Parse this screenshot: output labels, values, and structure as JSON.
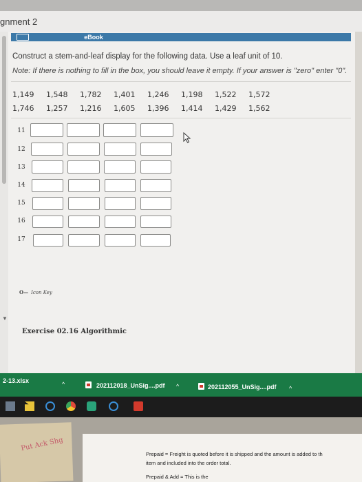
{
  "header": {
    "assignment_title": "gnment 2"
  },
  "ebook": {
    "label": "eBook"
  },
  "question": {
    "text": "Construct a stem-and-leaf display for the following data. Use a leaf unit of 10.",
    "note": "Note: If there is nothing to fill in the box, you should leave it empty. If your answer is \"zero\" enter \"0\"."
  },
  "data": {
    "row1": [
      "1,149",
      "1,548",
      "1,782",
      "1,401",
      "1,246",
      "1,198",
      "1,522",
      "1,572"
    ],
    "row2": [
      "1,746",
      "1,257",
      "1,216",
      "1,605",
      "1,396",
      "1,414",
      "1,429",
      "1,562"
    ]
  },
  "stems": [
    "11",
    "12",
    "13",
    "14",
    "15",
    "16",
    "17"
  ],
  "key": {
    "label": "Icon Key"
  },
  "exercise": {
    "label": "Exercise 02.16 Algorithmic"
  },
  "downloads": {
    "file1": "2-13.xlsx",
    "file2": "202112018_UnSig....pdf",
    "file3": "202112055_UnSig....pdf"
  },
  "paper": {
    "line1": "Prepaid = Freight is quoted before it is shipped and the amount is added to th",
    "line2": "item and included into the order total.",
    "line3": "Prepaid & Add = This is the"
  },
  "sticky": {
    "text": "Put Ack Shg"
  },
  "colors": {
    "ebook_bar": "#3c79a8",
    "download_bar": "#1a7a45",
    "taskbar": "#1c1c1c"
  }
}
